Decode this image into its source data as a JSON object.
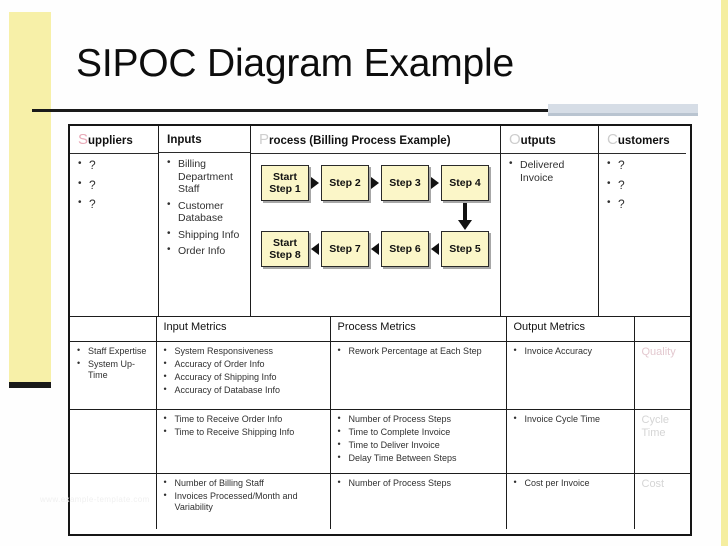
{
  "slide": {
    "title": "SIPOC Diagram Example"
  },
  "sipoc": {
    "columns": [
      {
        "cap": "S",
        "rest": "uppliers",
        "name": "suppliers"
      },
      {
        "cap": "I",
        "rest": "nputs",
        "name": "inputs"
      },
      {
        "cap": "P",
        "rest": "rocess (Billing Process Example)",
        "name": "process"
      },
      {
        "cap": "O",
        "rest": "utputs",
        "name": "outputs"
      },
      {
        "cap": "C",
        "rest": "ustomers",
        "name": "customers"
      }
    ],
    "suppliers_items": [
      "?",
      "?",
      "?"
    ],
    "inputs_items": [
      "Billing Department Staff",
      "Customer Database",
      "Shipping Info",
      "Order Info"
    ],
    "outputs_items": [
      "Delivered Invoice"
    ],
    "customers_items": [
      "?",
      "?",
      "?"
    ]
  },
  "process_flow": {
    "row1": [
      "Start Step 1",
      "Step 2",
      "Step 3",
      "Step 4"
    ],
    "row2": [
      "Step 5",
      "Step 6",
      "Step 7",
      "Start Step 8"
    ],
    "row1_direction": "left-to-right",
    "row2_direction": "right-to-left",
    "connector": "down-arrow-from-step-4-to-step-5"
  },
  "metrics": {
    "headers": [
      "",
      "Input Metrics",
      "Process Metrics",
      "Output Metrics",
      ""
    ],
    "rows": [
      {
        "dimension": "Quality",
        "supplier_metrics": [
          "Staff Expertise",
          "System Up-Time"
        ],
        "input_metrics": [
          "System Responsiveness",
          "Accuracy of Order Info",
          "Accuracy of Shipping Info",
          "Accuracy of Database Info"
        ],
        "process_metrics": [
          "Rework Percentage at Each Step"
        ],
        "output_metrics": [
          "Invoice Accuracy"
        ]
      },
      {
        "dimension": "Cycle Time",
        "supplier_metrics": [],
        "input_metrics": [
          "Time to Receive Order Info",
          "Time to Receive Shipping Info"
        ],
        "process_metrics": [
          "Number of Process Steps",
          "Time to Complete Invoice",
          "Time to Deliver Invoice",
          "Delay Time Between Steps"
        ],
        "output_metrics": [
          "Invoice Cycle Time"
        ]
      },
      {
        "dimension": "Cost",
        "supplier_metrics": [],
        "input_metrics": [
          "Number of Billing Staff",
          "Invoices Processed/Month and Variability"
        ],
        "process_metrics": [
          "Number of Process Steps"
        ],
        "output_metrics": [
          "Cost per Invoice"
        ]
      }
    ]
  },
  "watermark": {
    "text": "www.example-template.com"
  },
  "colors": {
    "step_box_fill": "#fbf6c8",
    "step_box_border": "#2a2a2a",
    "accent_band": "#f7f0a8",
    "header_cap_s": "#e8aab8",
    "header_cap_muted": "#cdcdcd",
    "dimension_label": "#e3c8cf",
    "rule": "#1d1d1d"
  }
}
